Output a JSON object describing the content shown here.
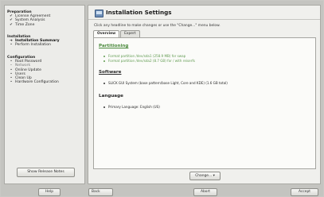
{
  "sidebar": {
    "groups": [
      {
        "title": "Preparation",
        "steps": [
          {
            "mark": "✔",
            "label": "License Agreement"
          },
          {
            "mark": "✔",
            "label": "System Analysis"
          },
          {
            "mark": "✔",
            "label": "Time Zone"
          }
        ]
      },
      {
        "title": "Installation",
        "steps": [
          {
            "mark": "➔",
            "label": "Installation Summary"
          },
          {
            "mark": "•",
            "label": "Perform Installation"
          }
        ]
      },
      {
        "title": "Configuration",
        "steps": [
          {
            "mark": "•",
            "label": "Root Password"
          },
          {
            "mark": "–",
            "label": "Network"
          },
          {
            "mark": "•",
            "label": "Online Update"
          },
          {
            "mark": "•",
            "label": "Users"
          },
          {
            "mark": "•",
            "label": "Clean Up"
          },
          {
            "mark": "•",
            "label": "Hardware Configuration"
          }
        ]
      }
    ],
    "release_notes_button": "Show Release Notes"
  },
  "main": {
    "title": "Installation Settings",
    "instructions": "Click any headline to make changes or use the \"Change...\" menu below.",
    "tabs": [
      "Overview",
      "Expert"
    ],
    "sections": {
      "partitioning": {
        "title": "Partitioning",
        "items": [
          "Format partition /dev/sda1 (258.9 MB) for swap",
          "Format partition /dev/sda2 (8.7 GB) for / with reiserfs"
        ]
      },
      "software": {
        "title": "Software",
        "items": [
          "SLICK GUI System (base pattern/base Light, Core and KDE) (1.6 GB total)"
        ]
      },
      "language": {
        "title": "Language",
        "items": [
          "Primary Language: English (US)"
        ]
      }
    },
    "change_button": "Change...",
    "change_arrow": "▾"
  },
  "footer": {
    "help": "Help",
    "back": "Back",
    "abort": "Abort",
    "accept": "Accept"
  }
}
